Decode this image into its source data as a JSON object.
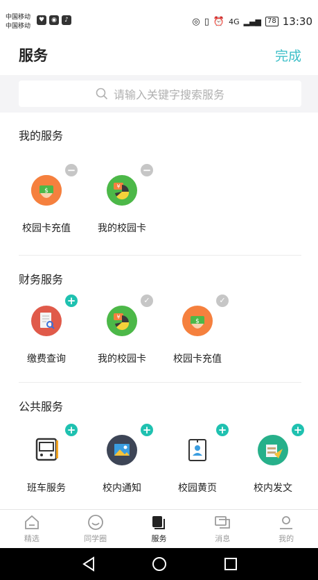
{
  "status_bar": {
    "carrier_line1": "中国移动",
    "carrier_line2": "中国移动",
    "battery": "78",
    "time": "13:30",
    "signal": "4G"
  },
  "header": {
    "title": "服务",
    "done_label": "完成"
  },
  "search": {
    "placeholder": "请输入关键字搜索服务"
  },
  "my_services": {
    "title": "我的服务",
    "items": [
      {
        "label": "校园卡充值",
        "icon": "card-recharge-icon"
      },
      {
        "label": "我的校园卡",
        "icon": "campus-card-icon"
      }
    ]
  },
  "finance_services": {
    "title": "财务服务",
    "items": [
      {
        "label": "缴费查询",
        "icon": "payment-query-icon"
      },
      {
        "label": "我的校园卡",
        "icon": "campus-card-icon"
      },
      {
        "label": "校园卡充值",
        "icon": "card-recharge-icon"
      }
    ]
  },
  "public_services": {
    "title": "公共服务",
    "items": [
      {
        "label": "班车服务",
        "icon": "bus-icon"
      },
      {
        "label": "校内通知",
        "icon": "notice-icon"
      },
      {
        "label": "校园黄页",
        "icon": "yellow-pages-icon"
      },
      {
        "label": "校内发文",
        "icon": "document-icon"
      }
    ]
  },
  "tabbar": {
    "items": [
      {
        "label": "精选",
        "icon": "home-icon"
      },
      {
        "label": "同学圈",
        "icon": "circle-icon"
      },
      {
        "label": "服务",
        "icon": "service-icon"
      },
      {
        "label": "消息",
        "icon": "message-icon"
      },
      {
        "label": "我的",
        "icon": "profile-icon"
      }
    ],
    "active": "服务"
  },
  "colors": {
    "accent": "#3dbfc8",
    "plus_badge": "#1fc1b0",
    "minus_badge": "#c6c6c6"
  }
}
